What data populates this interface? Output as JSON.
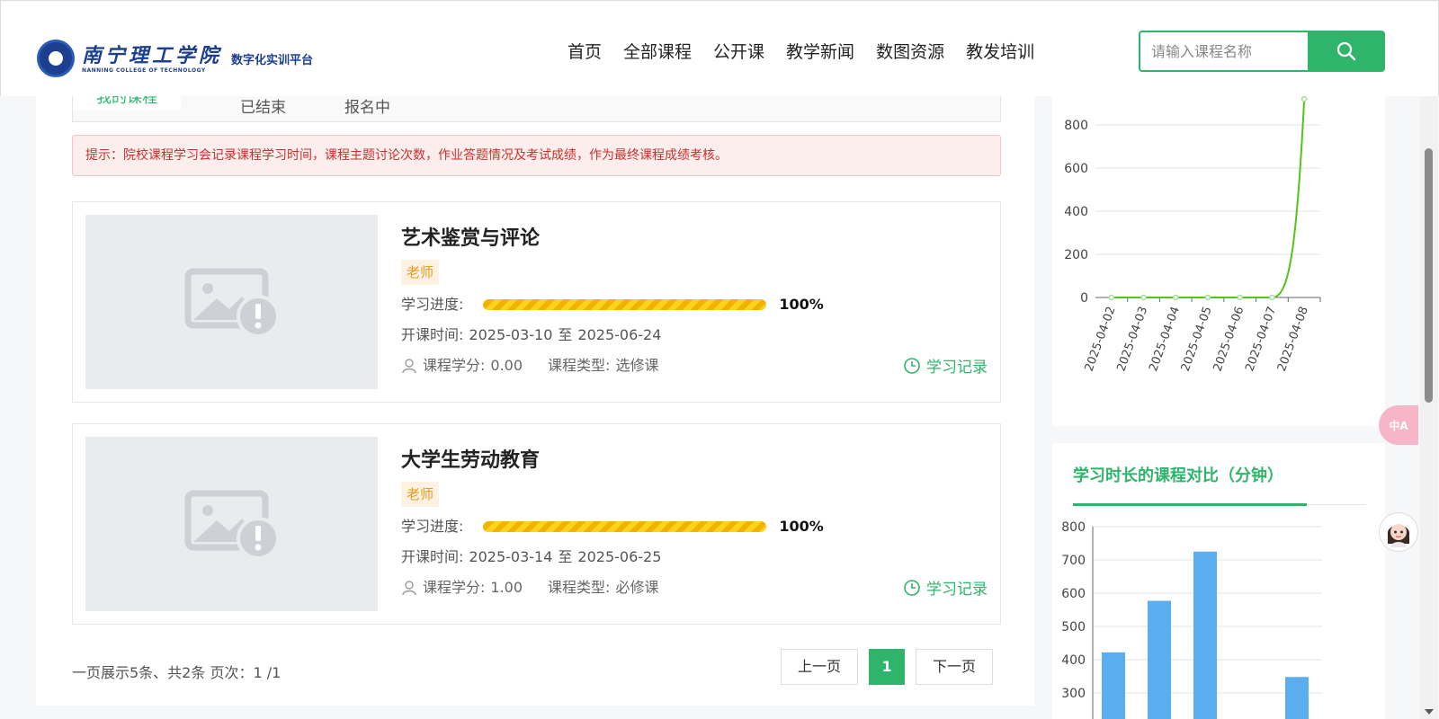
{
  "header": {
    "logo_cn": "南宁理工学院",
    "logo_en": "NANNING COLLEGE OF TECHNOLOGY",
    "logo_sub": "数字化实训平台",
    "nav": [
      "首页",
      "全部课程",
      "公开课",
      "教学新闻",
      "数图资源",
      "教发培训"
    ],
    "search_placeholder": "请输入课程名称"
  },
  "tabs": [
    "我的课程",
    "已结束",
    "报名中"
  ],
  "notice": "提示：院校课程学习会记录课程学习时间，课程主题讨论次数，作业答题情况及考试成绩，作为最终课程成绩考核。",
  "labels": {
    "progress": "学习进度:",
    "open_time": "开课时间:",
    "credit": "课程学分:",
    "type": "课程类型:",
    "record": "学习记录",
    "to": "至"
  },
  "courses": [
    {
      "title": "艺术鉴赏与评论",
      "badge": "老师",
      "progress": 100,
      "progress_text": "100%",
      "start": "2025-03-10",
      "end": "2025-06-24",
      "credit": "0.00",
      "type": "选修课"
    },
    {
      "title": "大学生劳动教育",
      "badge": "老师",
      "progress": 100,
      "progress_text": "100%",
      "start": "2025-03-14",
      "end": "2025-06-25",
      "credit": "1.00",
      "type": "必修课"
    }
  ],
  "pagination": {
    "info": "一页展示5条、共2条 页次：1 /1",
    "prev": "上一页",
    "current": "1",
    "next": "下一页"
  },
  "side2_title": "学习时长的课程对比（分钟）",
  "float_translate": "中A",
  "colors": {
    "accent": "#2fb46b",
    "line_series": "#52c41a",
    "bar_series": "#5aaef0",
    "badge": "#e59a22",
    "notice": "#c9302c"
  },
  "chart_data": [
    {
      "type": "line",
      "x": [
        "2025-04-02",
        "2025-04-03",
        "2025-04-04",
        "2025-04-05",
        "2025-04-06",
        "2025-04-07",
        "2025-04-08"
      ],
      "values": [
        0,
        0,
        0,
        0,
        0,
        0,
        920
      ],
      "yticks": [
        0,
        200,
        400,
        600,
        800
      ],
      "ylim": [
        0,
        900
      ],
      "grid": true,
      "title": "",
      "xlabel": "",
      "ylabel": ""
    },
    {
      "type": "bar",
      "title": "学习时长的课程对比（分钟）",
      "values": [
        422,
        577,
        725,
        null,
        348
      ],
      "yticks": [
        300,
        400,
        500,
        600,
        700,
        800
      ],
      "ylim": [
        300,
        800
      ],
      "grid": true,
      "xlabel": "",
      "ylabel": ""
    }
  ]
}
